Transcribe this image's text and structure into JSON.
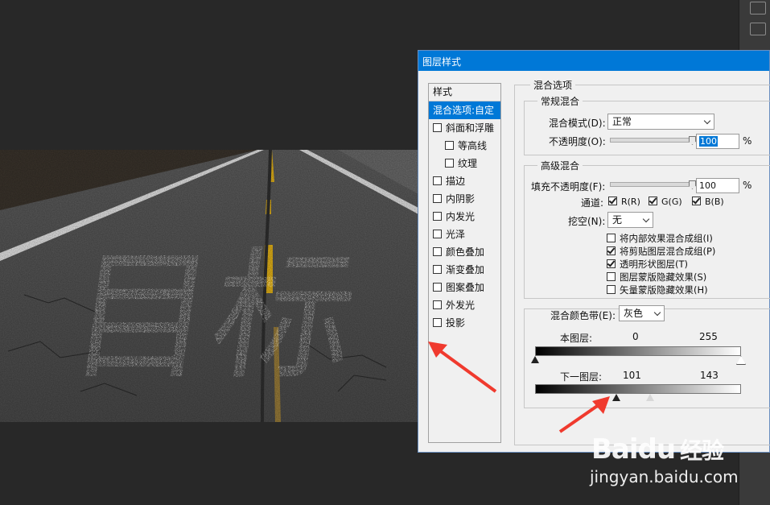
{
  "dialog": {
    "title": "图层样式",
    "styles_header": "样式",
    "style_items": [
      {
        "label": "混合选项:自定",
        "checkbox": false,
        "selected": true,
        "sub": false
      },
      {
        "label": "斜面和浮雕",
        "checkbox": true,
        "checked": false,
        "sub": false
      },
      {
        "label": "等高线",
        "checkbox": true,
        "checked": false,
        "sub": true
      },
      {
        "label": "纹理",
        "checkbox": true,
        "checked": false,
        "sub": true
      },
      {
        "label": "描边",
        "checkbox": true,
        "checked": false,
        "sub": false
      },
      {
        "label": "内阴影",
        "checkbox": true,
        "checked": false,
        "sub": false
      },
      {
        "label": "内发光",
        "checkbox": true,
        "checked": false,
        "sub": false
      },
      {
        "label": "光泽",
        "checkbox": true,
        "checked": false,
        "sub": false
      },
      {
        "label": "颜色叠加",
        "checkbox": true,
        "checked": false,
        "sub": false
      },
      {
        "label": "渐变叠加",
        "checkbox": true,
        "checked": false,
        "sub": false
      },
      {
        "label": "图案叠加",
        "checkbox": true,
        "checked": false,
        "sub": false
      },
      {
        "label": "外发光",
        "checkbox": true,
        "checked": false,
        "sub": false
      },
      {
        "label": "投影",
        "checkbox": true,
        "checked": false,
        "sub": false
      }
    ],
    "blend_options": {
      "title": "混合选项",
      "general": {
        "title": "常规混合",
        "blend_mode_label": "混合模式(D):",
        "blend_mode_value": "正常",
        "opacity_label": "不透明度(O):",
        "opacity_value": "100",
        "opacity_level": 1.0,
        "percent": "%"
      },
      "advanced": {
        "title": "高级混合",
        "fill_opacity_label": "填充不透明度(F):",
        "fill_opacity_value": "100",
        "fill_opacity_level": 1.0,
        "percent": "%",
        "channels_label": "通道:",
        "channels": [
          {
            "label": "R(R)",
            "checked": true
          },
          {
            "label": "G(G)",
            "checked": true
          },
          {
            "label": "B(B)",
            "checked": true
          }
        ],
        "knockout_label": "挖空(N):",
        "knockout_value": "无",
        "options": [
          {
            "label": "将内部效果混合成组(I)",
            "checked": false
          },
          {
            "label": "将剪贴图层混合成组(P)",
            "checked": true
          },
          {
            "label": "透明形状图层(T)",
            "checked": true
          },
          {
            "label": "图层蒙版隐藏效果(S)",
            "checked": false
          },
          {
            "label": "矢量蒙版隐藏效果(H)",
            "checked": false
          }
        ]
      },
      "blend_if": {
        "label": "混合颜色带(E):",
        "value": "灰色",
        "this_layer_label": "本图层:",
        "this_layer_low": "0",
        "this_layer_high": "255",
        "this_layer_low_value": 0,
        "this_layer_high_value": 255,
        "underlying_label": "下一图层:",
        "underlying_low": "101",
        "underlying_high": "143",
        "underlying_low_value": 101,
        "underlying_high_value": 143
      }
    }
  },
  "canvas": {
    "text": "目标"
  },
  "watermark": {
    "brand": "Baidu",
    "brand_cn": "经验",
    "url": "jingyan.baidu.com"
  },
  "colors": {
    "accent": "#0078d7",
    "arrow": "#f03a2e",
    "workspace": "#282828"
  }
}
